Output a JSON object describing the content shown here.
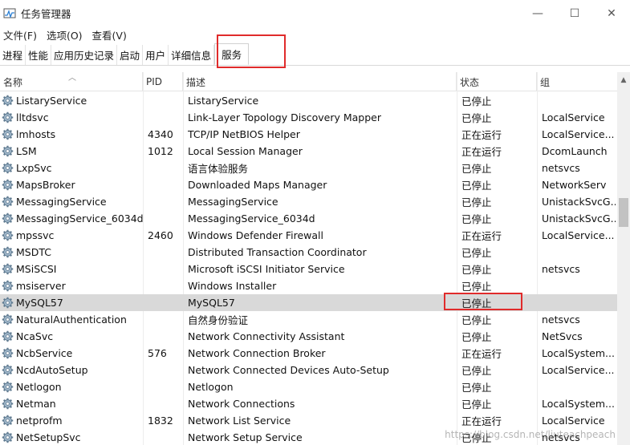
{
  "window": {
    "title": "任务管理器",
    "controls": {
      "minimize": "—",
      "maximize": "☐",
      "close": "✕"
    }
  },
  "menu": [
    "文件(F)",
    "选项(O)",
    "查看(V)"
  ],
  "tabs": [
    {
      "label": "进程",
      "active": false
    },
    {
      "label": "性能",
      "active": false
    },
    {
      "label": "应用历史记录",
      "active": false
    },
    {
      "label": "启动",
      "active": false
    },
    {
      "label": "用户",
      "active": false
    },
    {
      "label": "详细信息",
      "active": false
    },
    {
      "label": "服务",
      "active": true
    }
  ],
  "columns": {
    "name": "名称",
    "pid": "PID",
    "desc": "描述",
    "status": "状态",
    "group": "组"
  },
  "rows": [
    {
      "name": "ListaryService",
      "pid": "",
      "desc": "ListaryService",
      "status": "已停止",
      "group": ""
    },
    {
      "name": "lltdsvc",
      "pid": "",
      "desc": "Link-Layer Topology Discovery Mapper",
      "status": "已停止",
      "group": "LocalService"
    },
    {
      "name": "lmhosts",
      "pid": "4340",
      "desc": "TCP/IP NetBIOS Helper",
      "status": "正在运行",
      "group": "LocalService..."
    },
    {
      "name": "LSM",
      "pid": "1012",
      "desc": "Local Session Manager",
      "status": "正在运行",
      "group": "DcomLaunch"
    },
    {
      "name": "LxpSvc",
      "pid": "",
      "desc": "语言体验服务",
      "status": "已停止",
      "group": "netsvcs"
    },
    {
      "name": "MapsBroker",
      "pid": "",
      "desc": "Downloaded Maps Manager",
      "status": "已停止",
      "group": "NetworkServ"
    },
    {
      "name": "MessagingService",
      "pid": "",
      "desc": "MessagingService",
      "status": "已停止",
      "group": "UnistackSvcG..."
    },
    {
      "name": "MessagingService_6034d",
      "pid": "",
      "desc": "MessagingService_6034d",
      "status": "已停止",
      "group": "UnistackSvcG..."
    },
    {
      "name": "mpssvc",
      "pid": "2460",
      "desc": "Windows Defender Firewall",
      "status": "正在运行",
      "group": "LocalService..."
    },
    {
      "name": "MSDTC",
      "pid": "",
      "desc": "Distributed Transaction Coordinator",
      "status": "已停止",
      "group": ""
    },
    {
      "name": "MSiSCSI",
      "pid": "",
      "desc": "Microsoft iSCSI Initiator Service",
      "status": "已停止",
      "group": "netsvcs"
    },
    {
      "name": "msiserver",
      "pid": "",
      "desc": "Windows Installer",
      "status": "已停止",
      "group": ""
    },
    {
      "name": "MySQL57",
      "pid": "",
      "desc": "MySQL57",
      "status": "已停止",
      "group": "",
      "selected": true
    },
    {
      "name": "NaturalAuthentication",
      "pid": "",
      "desc": "自然身份验证",
      "status": "已停止",
      "group": "netsvcs"
    },
    {
      "name": "NcaSvc",
      "pid": "",
      "desc": "Network Connectivity Assistant",
      "status": "已停止",
      "group": "NetSvcs"
    },
    {
      "name": "NcbService",
      "pid": "576",
      "desc": "Network Connection Broker",
      "status": "正在运行",
      "group": "LocalSystem..."
    },
    {
      "name": "NcdAutoSetup",
      "pid": "",
      "desc": "Network Connected Devices Auto-Setup",
      "status": "已停止",
      "group": "LocalService..."
    },
    {
      "name": "Netlogon",
      "pid": "",
      "desc": "Netlogon",
      "status": "已停止",
      "group": ""
    },
    {
      "name": "Netman",
      "pid": "",
      "desc": "Network Connections",
      "status": "已停止",
      "group": "LocalSystem..."
    },
    {
      "name": "netprofm",
      "pid": "1832",
      "desc": "Network List Service",
      "status": "正在运行",
      "group": "LocalService"
    },
    {
      "name": "NetSetupSvc",
      "pid": "",
      "desc": "Network Setup Service",
      "status": "已停止",
      "group": "netsvcs"
    }
  ],
  "watermark": "https://blog.csdn.net/liuteachpeach",
  "colors": {
    "highlight": "#e02b2b",
    "selected_row": "#d9d9d9"
  }
}
